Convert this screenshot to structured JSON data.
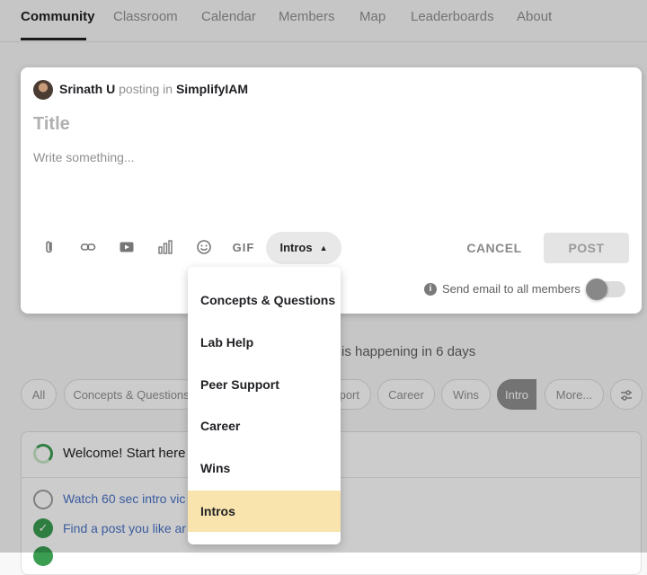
{
  "nav": {
    "tabs": [
      {
        "label": "Community",
        "active": true
      },
      {
        "label": "Classroom"
      },
      {
        "label": "Calendar"
      },
      {
        "label": "Members"
      },
      {
        "label": "Map"
      },
      {
        "label": "Leaderboards"
      },
      {
        "label": "About"
      }
    ]
  },
  "composer": {
    "author": "Srinath U",
    "posting_in": "posting in",
    "group": "SimplifyIAM",
    "title_placeholder": "Title",
    "body_placeholder": "Write something...",
    "toolbar_icons": [
      "attachment-icon",
      "link-icon",
      "video-icon",
      "poll-icon",
      "emoji-icon",
      "gif-icon"
    ],
    "gif_label": "GIF",
    "category_button": "Intros",
    "cancel_label": "CANCEL",
    "post_label": "POST",
    "email_label": "Send email to all members",
    "email_toggle_on": false
  },
  "dropdown": {
    "options": [
      "Concepts & Questions",
      "Lab Help",
      "Peer Support",
      "Career",
      "Wins",
      "Intros"
    ],
    "highlighted": "Intros"
  },
  "background": {
    "event_text": "is happening in 6 days",
    "filter_chips": [
      "All",
      "Concepts & Questions",
      "port",
      "Career",
      "Wins",
      "Intro",
      "More..."
    ],
    "selected_chip": "Intro",
    "welcome_title": "Welcome! Start here",
    "tasks": [
      {
        "text": "Watch 60 sec intro vic",
        "done": false
      },
      {
        "text": "Find a post you like ar",
        "done": true
      }
    ]
  },
  "colors": {
    "highlight": "#fae4ad",
    "overlay": "rgba(0,0,0,0.2)",
    "success": "#3a9d52",
    "link": "#4a73c7"
  }
}
